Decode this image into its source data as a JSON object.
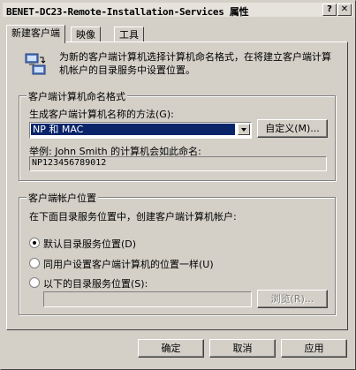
{
  "window": {
    "title": "BENET-DC23-Remote-Installation-Services 属性",
    "help_button": "?",
    "close_button": "✕"
  },
  "tabs": [
    {
      "label": "新建客户端",
      "active": true
    },
    {
      "label": "映像",
      "active": false
    },
    {
      "label": "工具",
      "active": false
    }
  ],
  "description": "为新的客户端计算机选择计算机命名格式，在将建立客户端计算机帐户的目录服务中设置位置。",
  "naming_group": {
    "label": "客户端计算机命名格式",
    "method_label": "生成客户端计算机名称的方法(G):",
    "method_value": "NP 和 MAC",
    "custom_button": "自定义(M)...",
    "example_label": "举例: John Smith 的计算机会如此命名:",
    "example_value": "NP123456789012"
  },
  "account_group": {
    "label": "客户端帐户位置",
    "instruction": "在下面目录服务位置中，创建客户端计算机帐户:",
    "options": [
      {
        "label": "默认目录服务位置(D)",
        "checked": true
      },
      {
        "label": "同用户设置客户端计算机的位置一样(U)",
        "checked": false
      },
      {
        "label": "以下的目录服务位置(S):",
        "checked": false
      }
    ],
    "path_value": "",
    "browse_button": "浏览(R)..."
  },
  "footer": {
    "ok_button": "确定",
    "cancel_button": "取消",
    "apply_button": "应用"
  }
}
